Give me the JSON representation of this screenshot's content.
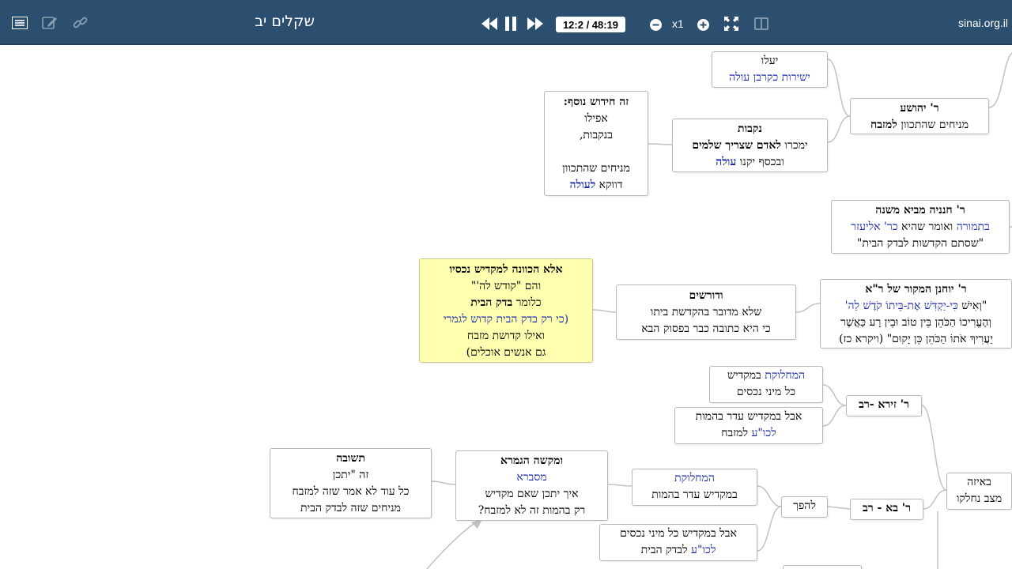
{
  "header": {
    "title": "שקלים יב",
    "timecode": "12:2 / 48:19",
    "speed": "x1",
    "site": "sinai.org.il"
  },
  "nodes": {
    "yalu": {
      "l1": "יעלו",
      "l2": "ישירות כקרבן עולה"
    },
    "yehoshua": {
      "l1": "ר' יהושע",
      "l2a": "מניחים שהתכוון ",
      "l2b": "למזבח"
    },
    "chiddush": {
      "l1": "זה חידוש נוסף:",
      "l2": "אפילו",
      "l3": "בנקבות,",
      "l4": "מניחים שהתכוון",
      "l5a": "דווקא ",
      "l5b": "לעולה"
    },
    "nekevot": {
      "l1": "נקבות",
      "l2a": "ימכרו ",
      "l2b": "לאדם שצריך שלמים",
      "l3a": "ובכסף יקנו ",
      "l3b": "עולה"
    },
    "chanina": {
      "l1": "ר' חנניה מביא משנה",
      "l2a": "בתמורה",
      "l2b": " ואומר שהיא ",
      "l2c": "כר' אליעזר",
      "l3": "\"שסתם הקדשות לבדק הבית\""
    },
    "yochanan": {
      "l1": "ר' יוחנן המקור של ר\"א",
      "l2a": "\"וְאִישׁ ",
      "l2b": "כִּי-יַקְדִּשׁ אֶת-בֵּיתוֹ קֹדֶשׁ לַה'",
      "l3": "וְהֶעֱרִיכוֹ הַכֹּהֵן בֵּין טוֹב וּבֵין רָע כַּאֲשֶׁר",
      "l4": "יַעֲרִיךְ אֹתוֹ הַכֹּהֵן כֵּן יָקוּם\" (ויקרא כז)"
    },
    "dorshim": {
      "l1": "ודורשים",
      "l2": "שלא מדובר בהקדשת ביתו",
      "l3": "כי היא כתובה כבר בפסוק הבא"
    },
    "ela": {
      "l1": "אלא הכוונה למקדיש נכסיו",
      "l2": "והם \"קודש לה'\"",
      "l3a": "כלומר ",
      "l3b": "בדק הבית",
      "l4": "(כי רק בדק הבית קדוש לגמרי",
      "l5": "ואילו קדושת מזבח",
      "l6": "גם אנשים אוכלים)"
    },
    "machloket1": {
      "l1a": "המחלוקת",
      "l1b": " במקדיש",
      "l2": "כל מיני נכסים"
    },
    "aval1": {
      "l1": "אבל במקדיש עדר בהמות",
      "l2a": "לכו\"ע",
      "l2b": " למזבח"
    },
    "zeira": {
      "l1": "ר' זירא -רב"
    },
    "teshuva": {
      "l1": "תשובה",
      "l2": "זה \"יתכן",
      "l3": "כל עוד לא אמר שזה למזבח",
      "l4": "מניחים שזה לבדק הבית"
    },
    "makshe": {
      "l1": "ומקשה הגמרא",
      "l2": "מסברא",
      "l3": "איך יתכן שאם מקדיש",
      "l4": "רק בהמות זה לא למזבח?"
    },
    "machloket2": {
      "l1": "המחלוקת",
      "l2": "במקדיש עדר בהמות"
    },
    "lehefech": {
      "l1": "להפך"
    },
    "ba": {
      "l1": "ר' בא - רב"
    },
    "aval2": {
      "l1": "אבל במקדיש כל מיני נכסים",
      "l2a": "לכו\"ע",
      "l2b": " לבדק הבית"
    },
    "beeize": {
      "l1": "באיזה",
      "l2": "מצב נחלקו"
    }
  },
  "colors": {
    "toolbar": "#2c4f6f",
    "highlight": "#ffffb0",
    "accent_text": "#1a2aa8"
  }
}
